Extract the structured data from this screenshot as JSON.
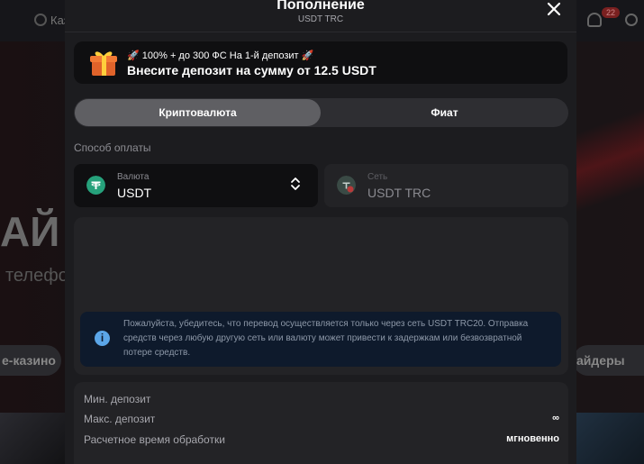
{
  "background": {
    "nav_left_text": "Казы",
    "hero_text": "АЙ",
    "hero_sub": "телефон",
    "pill_left": "е-казино",
    "pill_right": "айдеры",
    "notification_count": "22"
  },
  "modal": {
    "title": "Пополнение",
    "subtitle": "USDT TRC",
    "close_icon": "close-icon"
  },
  "promo": {
    "icon": "gift-icon",
    "line1": "🚀 100% + до 300 ФС На 1-й депозит 🚀",
    "line2": "Внесите депозит на сумму от 12.5 USDT"
  },
  "tabs": [
    {
      "label": "Криптовалюта",
      "active": true
    },
    {
      "label": "Фиат",
      "active": false
    }
  ],
  "payment": {
    "section_label": "Способ оплаты",
    "currency_caption": "Валюта",
    "currency_value": "USDT",
    "network_caption": "Сеть",
    "network_value": "USDT TRC"
  },
  "notice": {
    "text": "Пожалуйста, убедитесь, что перевод осуществляется только через сеть USDT TRC20. Отправка средств через любую другую сеть или валюту может привести к задержкам или безвозвратной потере средств."
  },
  "limits": [
    {
      "label": "Мин. депозит",
      "value": ""
    },
    {
      "label": "Макс. депозит",
      "value": "∞"
    },
    {
      "label": "Расчетное время обработки",
      "value": "мгновенно"
    }
  ],
  "colors": {
    "modal_bg": "#1c1c1f",
    "tether_green": "#26a17b",
    "notice_bg": "#0e1a2c",
    "info_blue": "#5ba6e8"
  }
}
